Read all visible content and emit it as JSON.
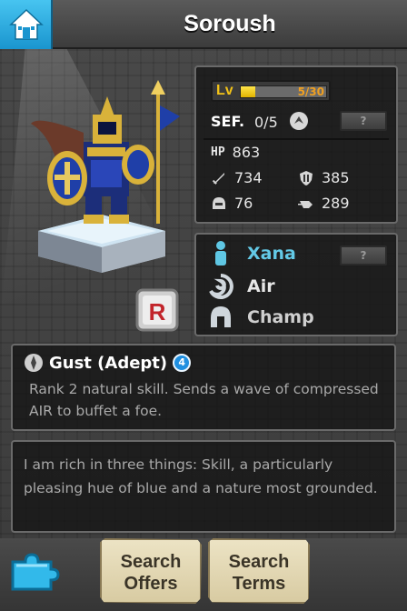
{
  "header": {
    "title": "Soroush",
    "home_icon": "home-icon"
  },
  "hero": {
    "rarity": "R",
    "level": {
      "label": "Lv",
      "current": 5,
      "max": 30,
      "text": "5/30"
    },
    "sef": {
      "label": "SEF.",
      "value": "0/5"
    },
    "help_button_label": "?",
    "stats": {
      "hp_label": "HP",
      "hp": "863",
      "attack": "734",
      "defense": "385",
      "recovery": "76",
      "speed": "289"
    },
    "info": {
      "name": "Xana",
      "element": "Air",
      "class": "Champ"
    }
  },
  "skill": {
    "name": "Gust (Adept)",
    "rank": "4",
    "description": "Rank 2 natural skill. Sends a wave of compressed AIR to buffet a foe."
  },
  "bio": "I am rich in three things: Skill, a particularly pleasing hue of blue and a nature most grounded.",
  "bottom": {
    "search_offers": [
      "Search",
      "Offers"
    ],
    "search_terms": [
      "Search",
      "Terms"
    ]
  },
  "colors": {
    "accent_blue": "#1a95cf",
    "level_bar": "#f3c318",
    "name_color": "#63c9e6",
    "text_muted": "#a9a9a9"
  }
}
